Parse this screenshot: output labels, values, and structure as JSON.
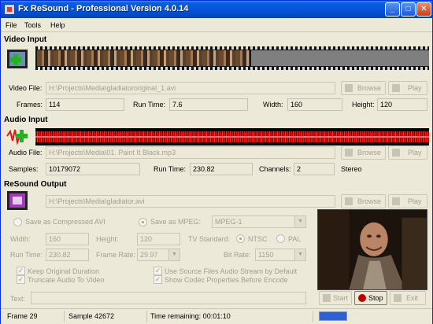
{
  "window": {
    "title": "Fx ReSound - Professional Version 4.0.14"
  },
  "menu": [
    "File",
    "Tools",
    "Help"
  ],
  "video_input": {
    "heading": "Video Input",
    "file_label": "Video File:",
    "file_value": "H:\\Projects\\Media\\gladiatororiginal_1.avi",
    "browse_label": "Browse",
    "play_label": "Play",
    "frames_label": "Frames:",
    "frames_value": "114",
    "runtime_label": "Run Time:",
    "runtime_value": "7.6",
    "width_label": "Width:",
    "width_value": "160",
    "height_label": "Height:",
    "height_value": "120"
  },
  "audio_input": {
    "heading": "Audio Input",
    "file_label": "Audio File:",
    "file_value": "H:\\Projects\\Media\\01. Paint It Black.mp3",
    "browse_label": "Browse",
    "play_label": "Play",
    "samples_label": "Samples:",
    "samples_value": "10179072",
    "runtime_label": "Run Time:",
    "runtime_value": "230.82",
    "channels_label": "Channels:",
    "channels_value": "2",
    "stereo_label": "Stereo"
  },
  "resound_output": {
    "heading": "ReSound Output",
    "file_value": "H:\\Projects\\Media\\gladiator.avi",
    "browse_label": "Browse",
    "play_label": "Play",
    "save_avi_label": "Save as Compressed AVI",
    "save_mpeg_label": "Save as MPEG:",
    "mpeg_format": "MPEG-1",
    "width_label": "Width:",
    "width_value": "160",
    "height_label": "Height:",
    "height_value": "120",
    "tv_standard_label": "TV Standard:",
    "ntsc_label": "NTSC",
    "pal_label": "PAL",
    "runtime_label": "Run Time:",
    "runtime_value": "230.82",
    "framerate_label": "Frame Rate:",
    "framerate_value": "29.97",
    "bitrate_label": "Bit Rate:",
    "bitrate_value": "1150",
    "keep_duration_label": "Keep Original Duration",
    "truncate_audio_label": "Truncate Audio To Video",
    "use_first_stream_label": "Use Source Files Audio Stream by Default",
    "show_codec_label": "Show Codec Properties Before Encode",
    "text_label": "Text:",
    "text_value": "",
    "start_label": "Start",
    "stop_label": "Stop",
    "exit_label": "Exit"
  },
  "status": {
    "frame": "Frame 29",
    "sample": "Sample 42672",
    "time_remaining": "Time remaining: 00:01:10",
    "progress_fraction": 0.25
  },
  "colors": {
    "title_blue": "#0455d6",
    "wave_red": "#e11111",
    "progress_blue": "#2e5fd3"
  }
}
